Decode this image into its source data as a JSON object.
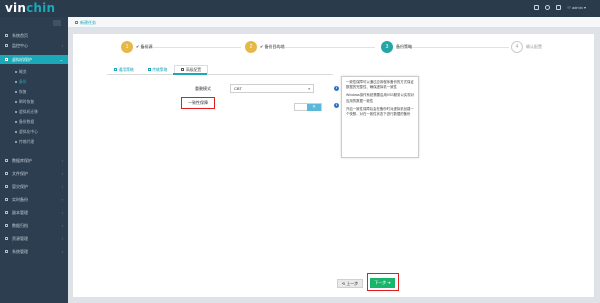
{
  "app": {
    "logo_text_1": "vin",
    "logo_text_2": "chin",
    "user": "admin"
  },
  "sidebar": {
    "items": [
      {
        "label": "系统首页"
      },
      {
        "label": "监控中心"
      },
      {
        "label": "虚拟机保护"
      },
      {
        "label": "数据库保护"
      },
      {
        "label": "文件保护"
      },
      {
        "label": "容灾保护"
      },
      {
        "label": "实时备份"
      },
      {
        "label": "副本管理"
      },
      {
        "label": "数据归档"
      },
      {
        "label": "资源管理"
      },
      {
        "label": "系统管理"
      }
    ],
    "sub_items": [
      {
        "label": "概览"
      },
      {
        "label": "备份"
      },
      {
        "label": "恢复"
      },
      {
        "label": "瞬时恢复"
      },
      {
        "label": "虚拟机迁移"
      },
      {
        "label": "备份数据"
      },
      {
        "label": "虚拟化中心"
      },
      {
        "label": "传输代理"
      }
    ]
  },
  "breadcrumb": {
    "label": "新建任务"
  },
  "steps": [
    {
      "num": "1",
      "check": "✔",
      "label": "备份源"
    },
    {
      "num": "2",
      "check": "✔",
      "label": "备份目的地"
    },
    {
      "num": "3",
      "label": "备份策略"
    },
    {
      "num": "4",
      "label": "确认配置"
    }
  ],
  "tabs": [
    {
      "label": "通用策略"
    },
    {
      "label": "传输策略"
    },
    {
      "label": "高级配置"
    }
  ],
  "form": {
    "compress_label": "重删模式",
    "compress_value": "CBT",
    "consistency_label": "一致性保障",
    "toggle_symbol": "✕"
  },
  "tooltip": {
    "p1": "一致性保障可以通过应用程序备份的方式保证数据的完整性、确保虚拟机一致性",
    "p2": "Windows操作系统需要启用VSS服务以实现对应用的数据一致性",
    "p3": "开启一致性保障后会在备份时对虚拟机创建一个快照，对在一致性状态下进行数据的备份"
  },
  "buttons": {
    "prev": "上一步",
    "next": "下一步"
  },
  "colors": {
    "accent": "#1ba8b8",
    "sidebar_bg": "#2c3e50",
    "step_done": "#e6b947",
    "step_current": "#24a6a6",
    "next_button": "#19b56a",
    "highlight": "#e02020"
  }
}
